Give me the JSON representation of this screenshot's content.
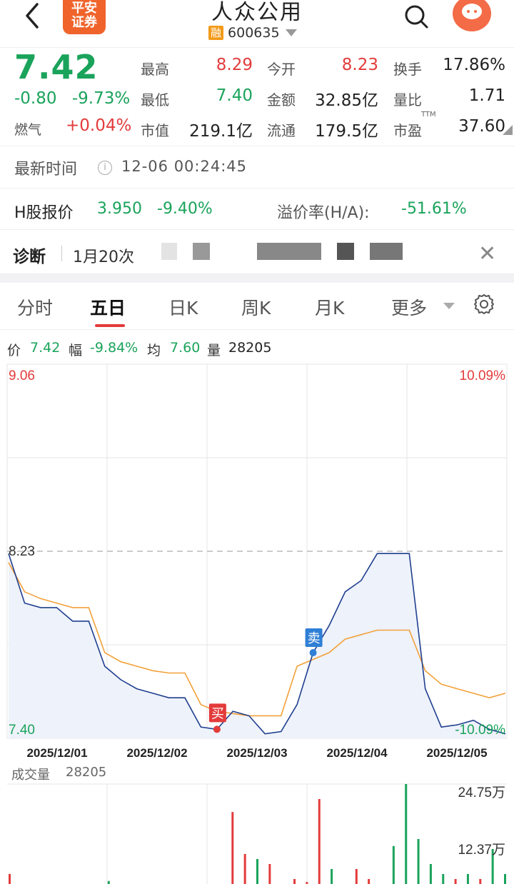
{
  "header": {
    "title": "人众公用",
    "logo_line1": "平安",
    "logo_line2": "证券",
    "tag": "融",
    "code": "600635"
  },
  "quote": {
    "price": "7.42",
    "change": "-0.80",
    "change_pct": "-9.73%",
    "fire_label": "燃气",
    "fire_pct": "+0.04%",
    "stats": [
      {
        "label": "最高",
        "value": "8.29",
        "color": "red"
      },
      {
        "label": "今开",
        "value": "8.23",
        "color": "red"
      },
      {
        "label": "换手",
        "value": "17.86%",
        "color": "dark"
      },
      {
        "label": "最低",
        "value": "7.40",
        "color": "green"
      },
      {
        "label": "金额",
        "value": "32.85亿",
        "color": "dark"
      },
      {
        "label": "量比",
        "value": "1.71",
        "color": "dark"
      },
      {
        "label": "市值",
        "value": "219.1亿",
        "color": "dark"
      },
      {
        "label": "流通",
        "value": "179.5亿",
        "color": "dark"
      },
      {
        "label": "市盈",
        "value": "37.60",
        "color": "dark"
      }
    ],
    "ttm": "TTM"
  },
  "latest": {
    "label": "最新时间",
    "time": "12-06 00:24:45"
  },
  "hshare": {
    "label": "H股报价",
    "price": "3.950",
    "change_pct": "-9.40%",
    "premium_label": "溢价率(H/A):",
    "premium": "-51.61%"
  },
  "diagnosis": {
    "label": "诊断",
    "text": "1月20次"
  },
  "tabs": [
    {
      "label": "分时",
      "active": false
    },
    {
      "label": "五日",
      "active": true
    },
    {
      "label": "日K",
      "active": false
    },
    {
      "label": "周K",
      "active": false
    },
    {
      "label": "月K",
      "active": false
    },
    {
      "label": "更多",
      "active": false
    }
  ],
  "legend": {
    "price_label": "价",
    "price": "7.42",
    "amp_label": "幅",
    "amp": "-9.84%",
    "avg_label": "均",
    "avg": "7.60",
    "vol_label": "量",
    "vol": "28205"
  },
  "chart_data": {
    "type": "line",
    "title": "",
    "x": [
      "2025/12/01",
      "2025/12/02",
      "2025/12/03",
      "2025/12/04",
      "2025/12/05"
    ],
    "ylim": [
      7.4,
      9.06
    ],
    "y_labels_left": [
      "9.06",
      "8.23",
      "7.40"
    ],
    "y_labels_right": [
      "10.09%",
      "-10.09%"
    ],
    "prev_close": 8.23,
    "series": [
      {
        "values": [
          8.22,
          8.0,
          7.98,
          7.98,
          7.92,
          7.92,
          7.72,
          7.66,
          7.62,
          7.6,
          7.58,
          7.58,
          7.45,
          7.44,
          7.52,
          7.5,
          7.42,
          7.43,
          7.55,
          7.78,
          7.9,
          8.05,
          8.1,
          8.22,
          8.22,
          8.22,
          7.62,
          7.45,
          7.46,
          7.48,
          7.44,
          7.42
        ]
      },
      {
        "values": [
          8.18,
          8.05,
          8.02,
          8.0,
          7.98,
          7.98,
          7.78,
          7.74,
          7.72,
          7.7,
          7.69,
          7.69,
          7.55,
          7.52,
          7.51,
          7.5,
          7.5,
          7.5,
          7.72,
          7.75,
          7.78,
          7.84,
          7.86,
          7.88,
          7.88,
          7.88,
          7.7,
          7.64,
          7.62,
          7.6,
          7.58,
          7.6
        ]
      }
    ],
    "annotations": [
      {
        "label": "买",
        "x": "2025/12/02"
      },
      {
        "label": "卖",
        "x": "2025/12/04"
      }
    ],
    "volume_label": "成交量",
    "volume": "28205",
    "volume_ticks": [
      "24.75万",
      "12.37万"
    ],
    "volume_bars": [
      0.1,
      0,
      0,
      0,
      0,
      0,
      0,
      0,
      0.03,
      0,
      0,
      0,
      0,
      0,
      0,
      0,
      0,
      0,
      0.72,
      0.3,
      0.25,
      0.2,
      0,
      0.05,
      0.02,
      0.85,
      0.15,
      0,
      0.15,
      0.05,
      0,
      0.38,
      1.0,
      0.45,
      0.2,
      0.1,
      0.05,
      0.1,
      0.05,
      0.35,
      0.1
    ],
    "volume_colors": [
      "red",
      "red",
      "red",
      "red",
      "red",
      "red",
      "red",
      "red",
      "green",
      "red",
      "red",
      "red",
      "red",
      "red",
      "red",
      "red",
      "red",
      "red",
      "red",
      "red",
      "green",
      "red",
      "red",
      "red",
      "red",
      "red",
      "green",
      "green",
      "red",
      "red",
      "red",
      "green",
      "green",
      "green",
      "green",
      "green",
      "red",
      "green",
      "red",
      "green",
      "green"
    ],
    "line_color": "#1f3f8f",
    "avg_color": "#f2a13a",
    "up_color": "#e33b3b",
    "down_color": "#1aa35b"
  }
}
